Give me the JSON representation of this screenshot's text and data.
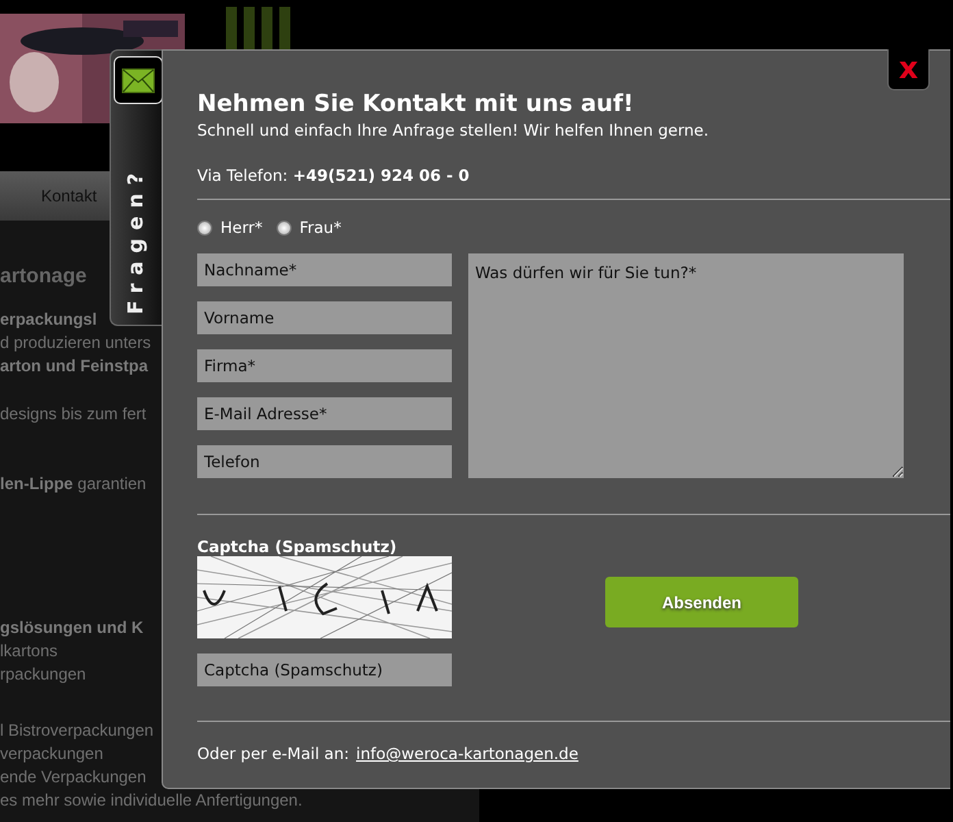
{
  "background_page": {
    "nav_item": "Kontakt",
    "heading": "artonage",
    "blocks": [
      {
        "lines": [
          {
            "text": "erpackungsl",
            "bold": true
          },
          {
            "text": "d produzieren unters",
            "bold": false
          },
          {
            "text": "arton und Feinstpa",
            "bold": true
          }
        ]
      },
      {
        "lines": [
          {
            "text": "designs bis zum fert",
            "bold": false
          }
        ]
      },
      {
        "lines": [
          {
            "text": "**len-Lippe** garantien",
            "bold": false
          }
        ]
      },
      {
        "lines": [
          {
            "text": "gslösungen und K",
            "bold": true
          },
          {
            "text": "lkartons",
            "bold": false
          },
          {
            "text": "rpackungen",
            "bold": false
          }
        ]
      },
      {
        "lines": [
          {
            "text": "l Bistroverpackungen",
            "bold": false
          },
          {
            "text": "verpackungen",
            "bold": false
          },
          {
            "text": "ende Verpackungen",
            "bold": false
          },
          {
            "text": "es mehr sowie individuelle Anfertigungen.",
            "bold": false
          }
        ]
      }
    ]
  },
  "side_tab": {
    "label": "Fragen?"
  },
  "dialog": {
    "close": "x",
    "title": "Nehmen Sie Kontakt mit uns auf!",
    "subtitle": "Schnell und einfach Ihre Anfrage stellen! Wir helfen Ihnen gerne.",
    "phone": "Via Telefon: **+49(521) 924 06 - 0**",
    "salutations": [
      {
        "label": "Herr*",
        "selected": false
      },
      {
        "label": "Frau*",
        "selected": false
      }
    ],
    "fields": [
      {
        "placeholder": "Nachname*"
      },
      {
        "placeholder": "Vorname"
      },
      {
        "placeholder": "Firma*"
      },
      {
        "placeholder": "E-Mail Adresse*"
      },
      {
        "placeholder": "Telefon"
      }
    ],
    "message": {
      "placeholder": "Was dürfen wir für Sie tun?*"
    },
    "captcha": {
      "label": "Captcha (Spamschutz)",
      "placeholder": "Captcha (Spamschutz)"
    },
    "submit": "Absenden",
    "email_prefix": "Oder per e-Mail an:",
    "email_link": "info@weroca-kartonagen.de"
  }
}
